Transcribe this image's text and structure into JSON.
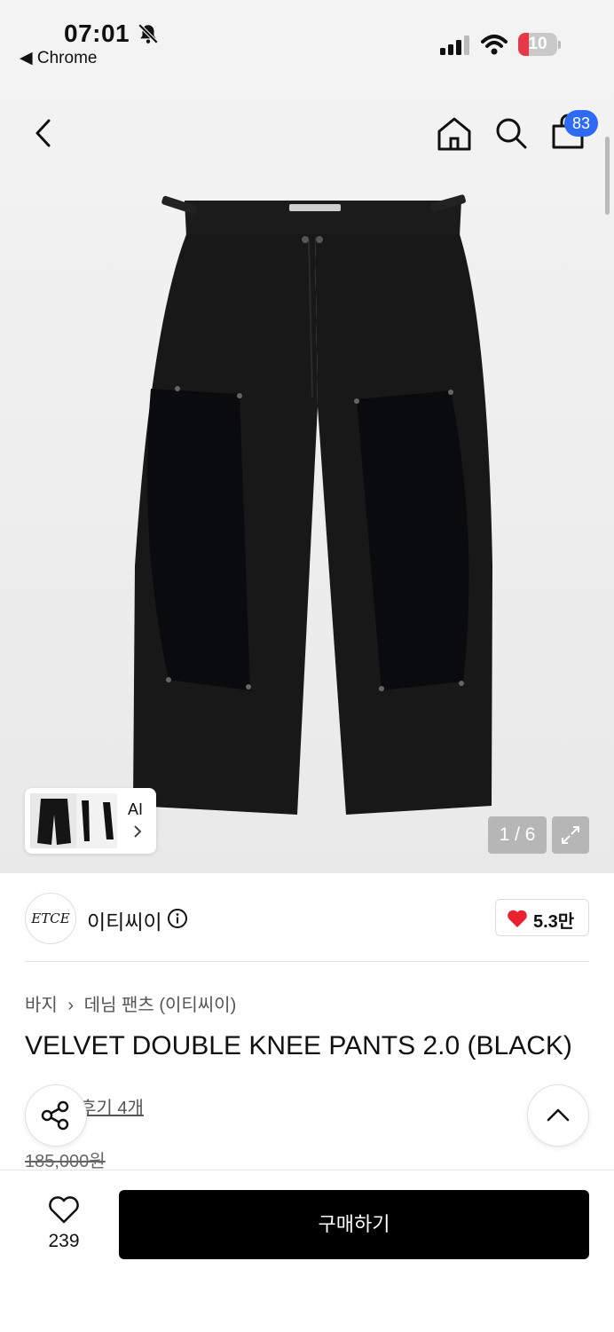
{
  "status_bar": {
    "time": "07:01",
    "back_app": "◀ Chrome",
    "battery": "10"
  },
  "nav": {
    "cart_count": "83"
  },
  "gallery": {
    "counter": "1 / 6",
    "ai_label": "AI"
  },
  "brand": {
    "logo_text": "ETCE",
    "name": "이티씨이",
    "likes": "5.3만"
  },
  "breadcrumb": {
    "category": "바지",
    "subcategory": "데님 팬츠 (이티씨이)"
  },
  "product": {
    "title": "VELVET DOUBLE KNEE PANTS 2.0 (BLACK)",
    "reviews": "후기 4개",
    "original_price": "185,000원"
  },
  "bottom_bar": {
    "wish_count": "239",
    "buy_label": "구매하기"
  },
  "colors": {
    "accent": "#2f6af5",
    "heart": "#e8232f",
    "buy_button": "#000000"
  }
}
